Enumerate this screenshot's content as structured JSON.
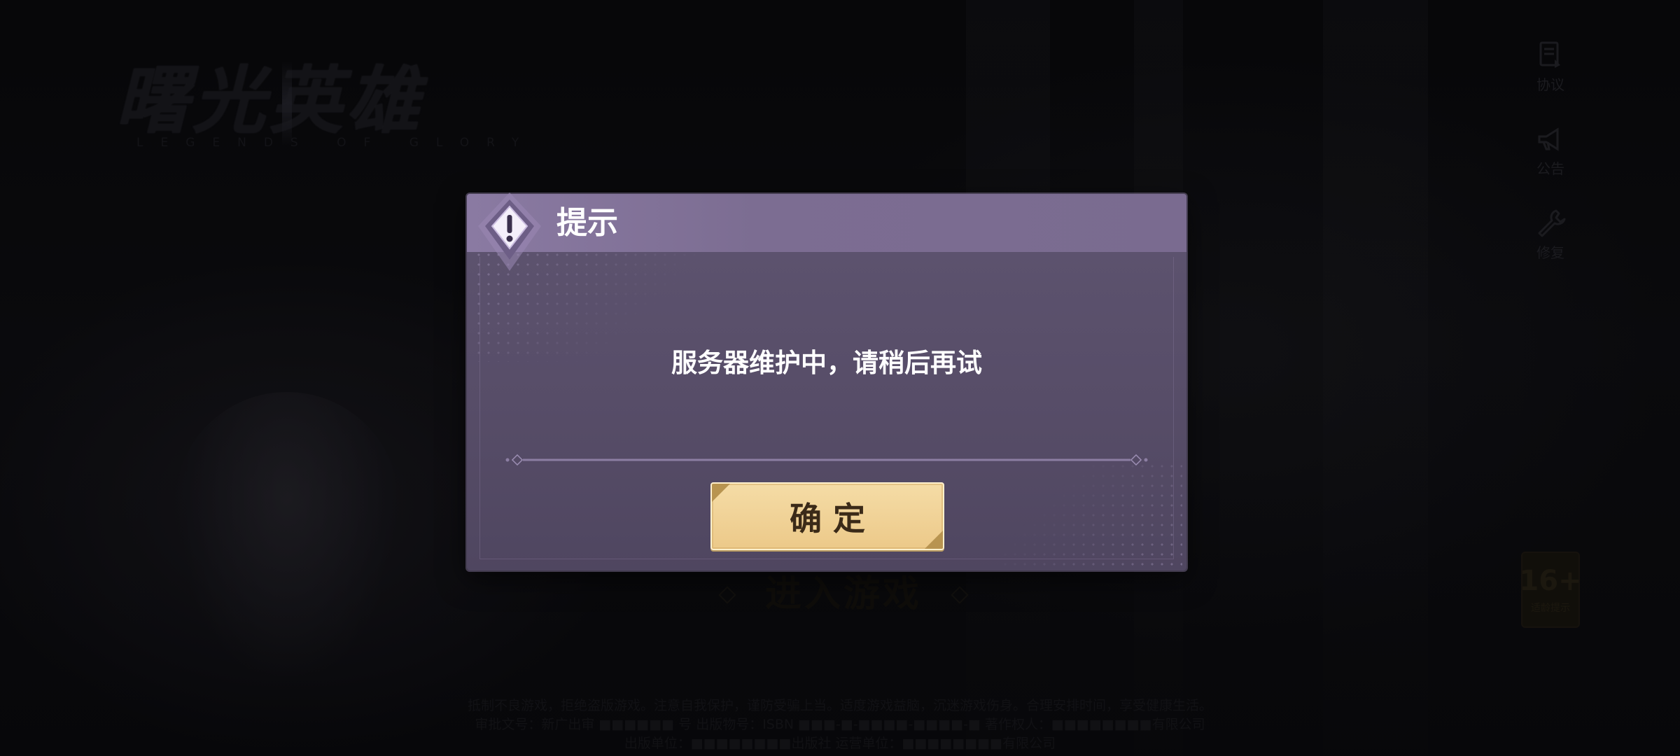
{
  "background": {
    "logo": {
      "title": "曙光英雄",
      "subtitle": "LEGENDS OF GLORY"
    },
    "side_menu": [
      {
        "label": "协议",
        "icon": "document-icon"
      },
      {
        "label": "公告",
        "icon": "megaphone-icon"
      },
      {
        "label": "修复",
        "icon": "wrench-icon"
      }
    ],
    "age_rating": {
      "value": "16+",
      "label": "适龄提示"
    },
    "enter_game_label": "进入游戏",
    "footer_lines": [
      "抵制不良游戏，拒绝盗版游戏。注意自我保护，谨防受骗上当。适度游戏益脑，沉迷游戏伤身。合理安排时间，享受健康生活。",
      "审批文号：新广出审 ■■■■■■ 号  出版物号：ISBN ■■■-■-■■■■-■■■■-■  著作权人：■■■■■■■■有限公司",
      "出版单位：■■■■■■■■出版社  运营单位：■■■■■■■■有限公司"
    ]
  },
  "dialog": {
    "title": "提示",
    "emblem_icon": "exclamation-icon",
    "message": "服务器维护中，请稍后再试",
    "confirm_label": "确定"
  },
  "colors": {
    "dialog_header": "#7c6d92",
    "dialog_body": "#574d68",
    "button_gold": "#ecc989",
    "button_text": "#3b2a18"
  }
}
